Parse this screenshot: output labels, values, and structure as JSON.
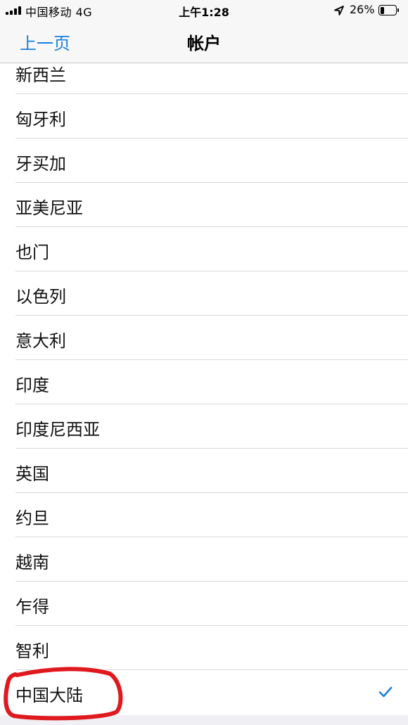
{
  "status_bar": {
    "carrier": "中国移动  4G",
    "time": "上午1:28",
    "battery_percent": "26%",
    "battery_level": 0.26,
    "icons": [
      "signal-icon",
      "location-icon",
      "battery-icon"
    ]
  },
  "nav": {
    "back_label": "上一页",
    "title": "帐户"
  },
  "list": {
    "items": [
      {
        "label": "新西兰"
      },
      {
        "label": "匈牙利"
      },
      {
        "label": "牙买加"
      },
      {
        "label": "亚美尼亚"
      },
      {
        "label": "也门"
      },
      {
        "label": "以色列"
      },
      {
        "label": "意大利"
      },
      {
        "label": "印度"
      },
      {
        "label": "印度尼西亚"
      },
      {
        "label": "英国"
      },
      {
        "label": "约旦"
      },
      {
        "label": "越南"
      },
      {
        "label": "乍得"
      },
      {
        "label": "智利"
      },
      {
        "label": "中国大陆",
        "selected": true
      }
    ]
  },
  "colors": {
    "accent": "#1a7fe0",
    "annotation": "#e0191f",
    "nav_background": "#f7f7f7",
    "separator": "#d8d8dc"
  }
}
